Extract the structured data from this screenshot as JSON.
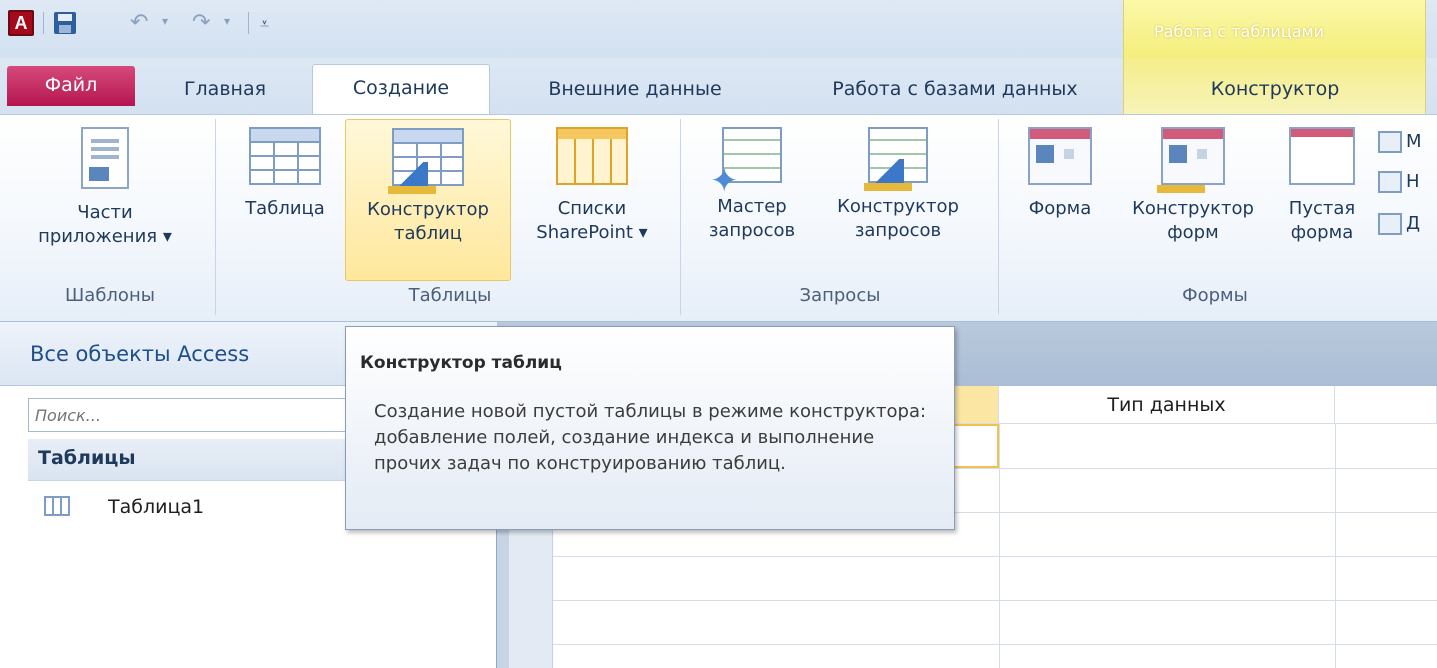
{
  "app": {
    "icon_letter": "A",
    "context_tab_group": "Работа с таблицами"
  },
  "tabs": [
    {
      "label": "Файл"
    },
    {
      "label": "Главная"
    },
    {
      "label": "Создание",
      "active": true
    },
    {
      "label": "Внешние данные"
    },
    {
      "label": "Работа с базами данных"
    },
    {
      "label": "Конструктор"
    }
  ],
  "ribbon": {
    "groups": {
      "templates": "Шаблоны",
      "tables": "Таблицы",
      "queries": "Запросы",
      "forms": "Формы"
    },
    "buttons": {
      "app_parts": [
        "Части",
        "приложения ▾"
      ],
      "table": [
        "Таблица"
      ],
      "table_design": [
        "Конструктор",
        "таблиц"
      ],
      "sharepoint": [
        "Списки",
        "SharePoint ▾"
      ],
      "query_wizard": [
        "Мастер",
        "запросов"
      ],
      "query_design": [
        "Конструктор",
        "запросов"
      ],
      "form": [
        "Форма"
      ],
      "form_design": [
        "Конструктор",
        "форм"
      ],
      "blank_form": [
        "Пустая",
        "форма"
      ],
      "small_items": [
        "М",
        "Н",
        "Д"
      ]
    }
  },
  "nav_pane": {
    "title": "Все объекты Access",
    "search_placeholder": "Поиск...",
    "group_label": "Таблицы",
    "items": [
      {
        "label": "Таблица1"
      }
    ]
  },
  "grid": {
    "headers": [
      "",
      "Тип данных",
      ""
    ]
  },
  "tooltip": {
    "title": "Конструктор таблиц",
    "body": "Создание новой пустой таблицы в режиме конструктора: добавление полей, создание индекса и выполнение прочих задач по конструированию таблиц."
  },
  "colors": {
    "file_tab": "#b3164f",
    "context_yellow": "#f4ee7c",
    "highlight": "#ffe89c"
  }
}
